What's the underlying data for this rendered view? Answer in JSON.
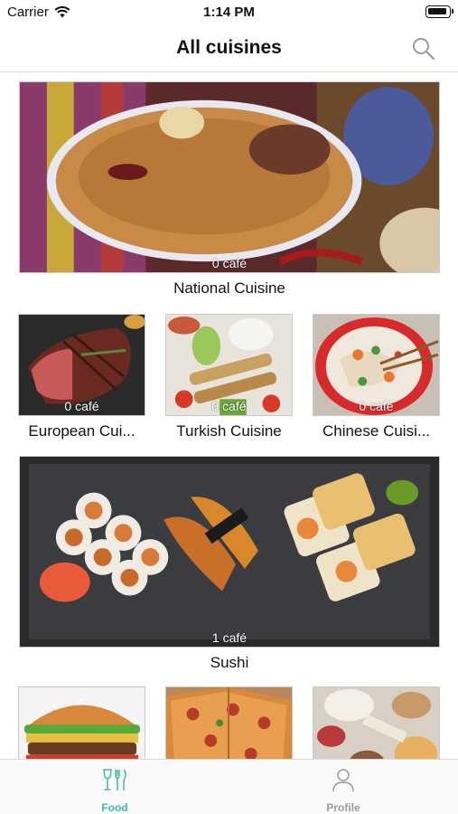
{
  "status_bar": {
    "carrier": "Carrier",
    "time": "1:14 PM"
  },
  "nav": {
    "title": "All cuisines",
    "search_icon": "search-icon"
  },
  "cuisines": [
    {
      "name": "National Cuisine",
      "cafe_count": "0 café"
    },
    {
      "name": "European Cui...",
      "cafe_count": "0 café"
    },
    {
      "name": "Turkish Cuisine",
      "cafe_count": "0 café"
    },
    {
      "name": "Chinese Cuisi...",
      "cafe_count": "0 café"
    },
    {
      "name": "Sushi",
      "cafe_count": "1 café"
    }
  ],
  "tab_bar": {
    "food": {
      "label": "Food",
      "icon": "fork-knife-glass-icon"
    },
    "profile": {
      "label": "Profile",
      "icon": "person-icon"
    }
  },
  "colors": {
    "accent": "#3fb8a9",
    "inactive": "#9b9b9b"
  }
}
